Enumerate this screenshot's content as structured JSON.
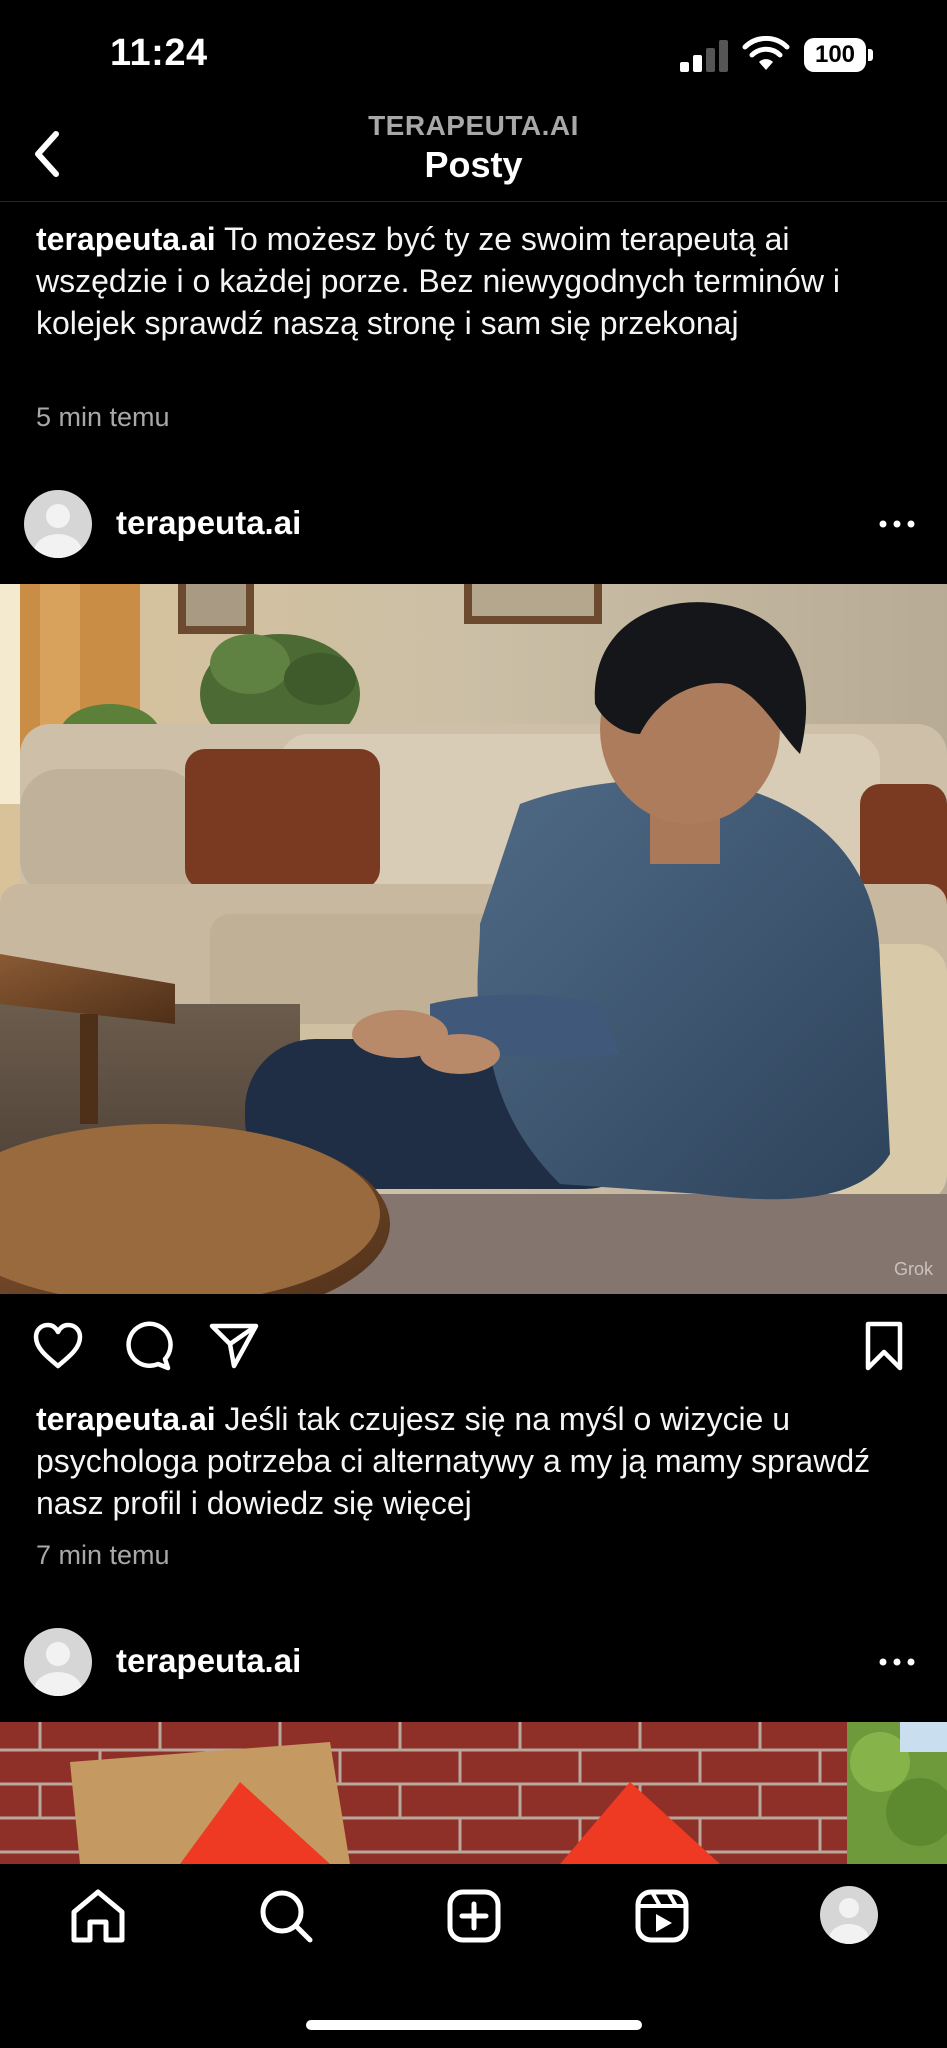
{
  "status_bar": {
    "time": "11:24",
    "battery": "100"
  },
  "header": {
    "account": "TERAPEUTA.AI",
    "title": "Posty"
  },
  "posts": [
    {
      "username": "terapeuta.ai",
      "caption": "To możesz być ty ze swoim terapeutą ai wszędzie i  o każdej porze. Bez niewygodnych terminów i kolejek sprawdź naszą stronę i sam się przekonaj",
      "time_ago": "5 min temu"
    },
    {
      "username": "terapeuta.ai",
      "image_watermark": "Grok",
      "caption": "Jeśli tak czujesz się na myśl o wizycie u psychologa potrzeba ci alternatywy a my ją mamy sprawdź nasz profil i dowiedz się więcej",
      "time_ago": "7 min temu"
    },
    {
      "username": "terapeuta.ai"
    }
  ],
  "icons": {
    "back": "chevron-left-icon",
    "more": "more-horizontal-icon",
    "like": "heart-icon",
    "comment": "comment-icon",
    "share": "paper-plane-icon",
    "save": "bookmark-icon",
    "nav": [
      "home-icon",
      "search-icon",
      "create-icon",
      "reels-icon",
      "profile-avatar"
    ]
  },
  "colors": {
    "background": "#000000",
    "secondary_text": "#a8a8a8",
    "text": "#f5f5f5"
  }
}
